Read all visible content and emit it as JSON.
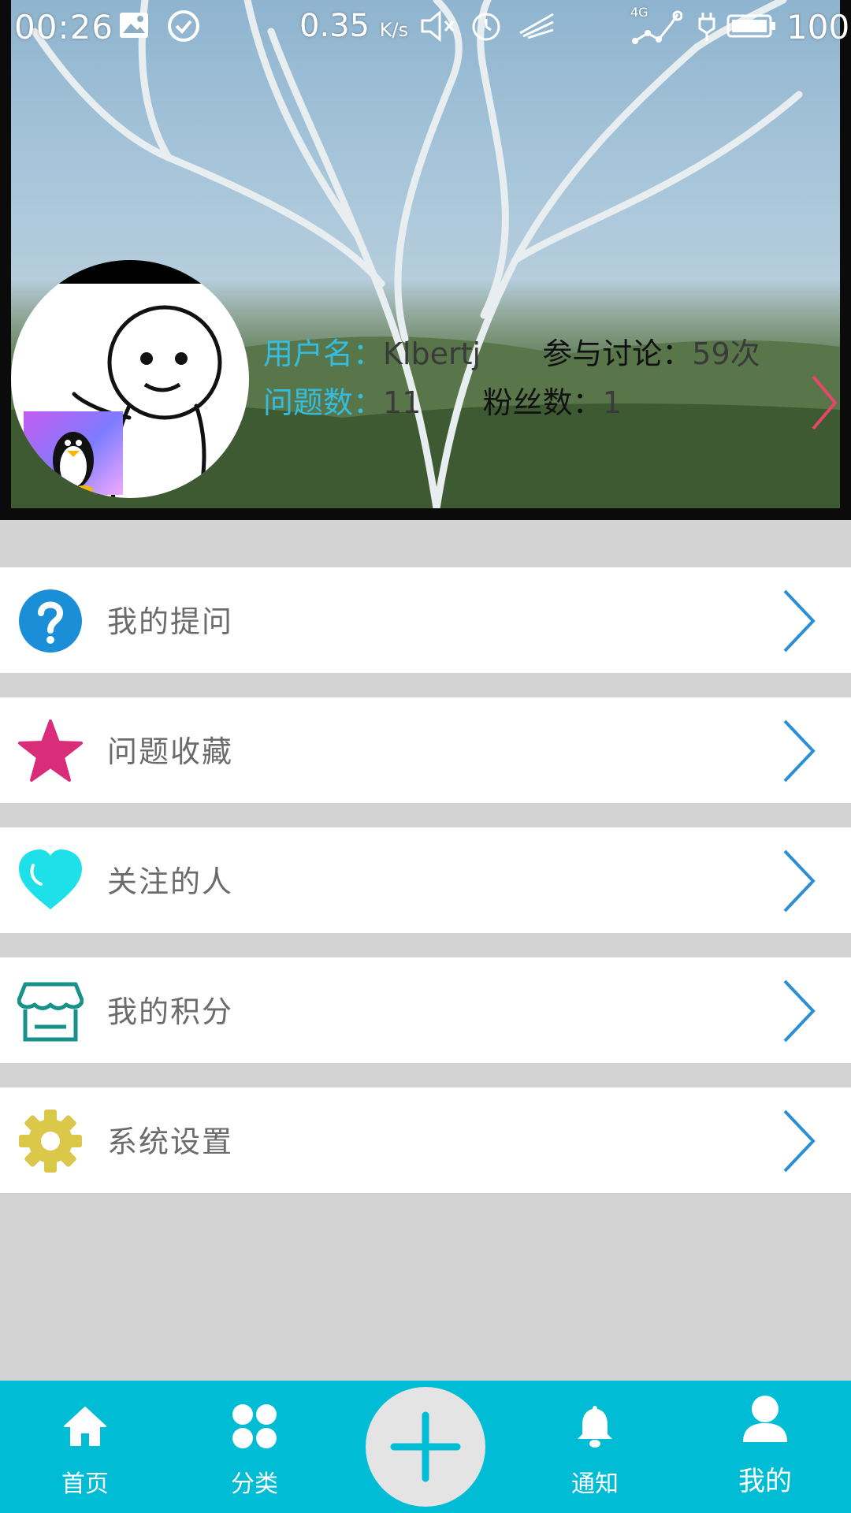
{
  "status_bar": {
    "time": "00:26",
    "net_speed": "0.35",
    "net_speed_unit": "K/s",
    "network_type": "4G",
    "battery": "100"
  },
  "profile": {
    "username_label": "用户名：",
    "username": "Klbertj",
    "discussions_label": "参与讨论：",
    "discussions": "59次",
    "questions_label": "问题数：",
    "questions": "11",
    "followers_label": "粉丝数：",
    "followers": "1"
  },
  "menu": [
    {
      "label": "我的提问",
      "icon": "question-icon",
      "color": "#1a8fd8"
    },
    {
      "label": "问题收藏",
      "icon": "star-icon",
      "color": "#d82d78"
    },
    {
      "label": "关注的人",
      "icon": "heart-icon",
      "color": "#1ee0e8"
    },
    {
      "label": "我的积分",
      "icon": "store-icon",
      "color": "#16928a"
    },
    {
      "label": "系统设置",
      "icon": "gear-icon",
      "color": "#d9c84a"
    }
  ],
  "bottom_nav": [
    {
      "label": "首页",
      "icon": "home-icon"
    },
    {
      "label": "分类",
      "icon": "grid-icon"
    },
    {
      "label": "",
      "icon": "plus-icon"
    },
    {
      "label": "通知",
      "icon": "bell-icon"
    },
    {
      "label": "我的",
      "icon": "person-icon",
      "active": true
    }
  ],
  "colors": {
    "accent": "#00bcd4",
    "arrow": "#2a8fd6",
    "background": "#d3d3d3",
    "label_cyan": "#33bde0"
  }
}
